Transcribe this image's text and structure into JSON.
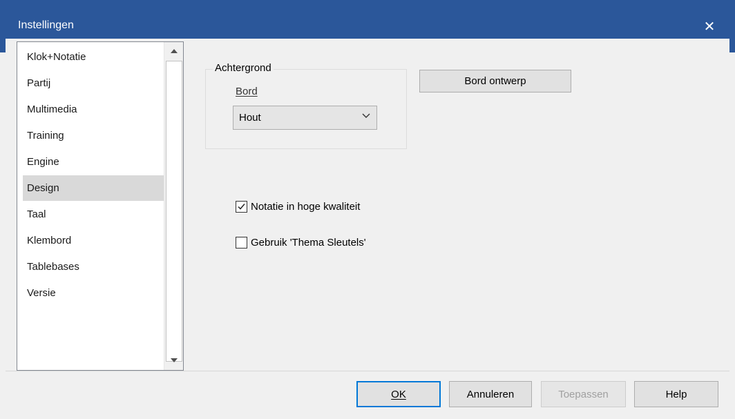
{
  "window": {
    "title": "Instellingen",
    "close_glyph": "✕"
  },
  "sidebar": {
    "items": [
      {
        "label": "Klok+Notatie"
      },
      {
        "label": "Partij"
      },
      {
        "label": "Multimedia"
      },
      {
        "label": "Training"
      },
      {
        "label": "Engine"
      },
      {
        "label": "Design",
        "selected": true
      },
      {
        "label": "Taal"
      },
      {
        "label": "Klembord"
      },
      {
        "label": "Tablebases"
      },
      {
        "label": "Versie"
      }
    ]
  },
  "background_group": {
    "legend": "Achtergrond",
    "board_label": "Bord",
    "board_value": "Hout"
  },
  "board_design_button": "Bord ontwerp",
  "options": {
    "high_quality_notation": {
      "label": "Notatie in hoge kwaliteit",
      "checked": true
    },
    "theme_keys": {
      "label": "Gebruik 'Thema Sleutels'",
      "checked": false
    }
  },
  "footer": {
    "ok": "OK",
    "cancel": "Annuleren",
    "apply": "Toepassen",
    "help": "Help"
  },
  "colors": {
    "titlebar": "#2b579a",
    "accent": "#0078d7",
    "selected_item": "#d9d9d9"
  }
}
